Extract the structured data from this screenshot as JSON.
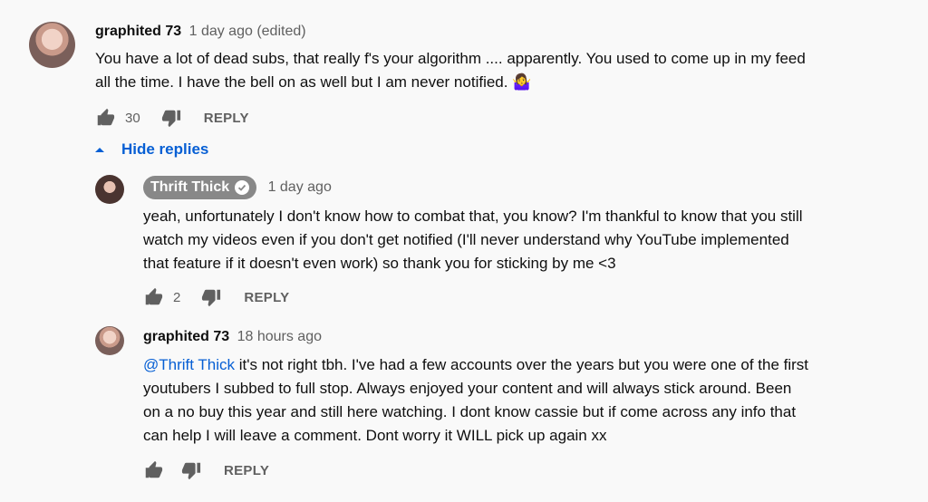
{
  "comment_top": {
    "author": "graphited 73",
    "time": "1 day ago (edited)",
    "text_line1": "You have a lot of dead subs, that really f's your algorithm .... apparently. You used to come up in my feed",
    "text_line2": "all the time. I have the bell on as well but I am never notified.",
    "emoji": "🤷‍♀️",
    "likes": "30",
    "reply_label": "REPLY"
  },
  "hide_replies_label": "Hide replies",
  "reply_creator": {
    "author": "Thrift Thick",
    "time": "1 day ago",
    "text_lines": [
      "yeah, unfortunately I don't know how to combat that, you know? I'm thankful to know that you still",
      "watch my videos even if you don't get notified (I'll never understand why YouTube implemented",
      "that feature if it doesn't even work) so thank you for sticking by me <3"
    ],
    "likes": "2",
    "reply_label": "REPLY"
  },
  "reply_user": {
    "author": "graphited 73",
    "time": "18 hours ago",
    "mention": "@Thrift Thick",
    "text_line1_rest": " it's not right tbh. I've had a few accounts over the years but you were one of the first",
    "text_lines": [
      "youtubers I subbed to full stop. Always enjoyed your content and will always stick around. Been",
      "on a no buy this year and still here watching. I dont know cassie but if come across any info that",
      "can help I will leave a comment. Dont worry it WILL pick up again xx"
    ],
    "reply_label": "REPLY"
  },
  "icons": {
    "like": "thumbs-up-icon",
    "dislike": "thumbs-down-icon",
    "caret": "caret-up-icon",
    "verified": "verified-check-icon"
  },
  "colors": {
    "link": "#065fd4",
    "meta": "#606060",
    "badge": "#888888"
  }
}
